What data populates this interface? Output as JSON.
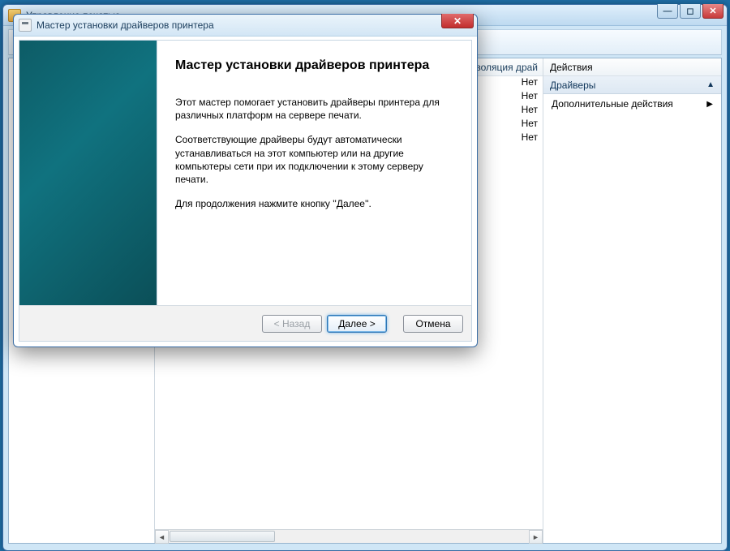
{
  "parent_window": {
    "title": "Управление печатью",
    "win_controls": {
      "min": "—",
      "max": "◻",
      "close": "✕"
    }
  },
  "mid_pane": {
    "column_header": "Изоляция драй",
    "rows": [
      "Нет",
      "Нет",
      "Нет",
      "Нет",
      "Нет"
    ]
  },
  "actions_pane": {
    "title": "Действия",
    "group": "Драйверы",
    "item": "Дополнительные действия"
  },
  "wizard": {
    "title": "Мастер установки драйверов принтера",
    "heading": "Мастер установки драйверов принтера",
    "para1": "Этот мастер помогает установить драйверы принтера для различных платформ на сервере печати.",
    "para2": "Соответствующие драйверы будут автоматически устанавливаться на этот компьютер или на другие компьютеры сети при их подключении к этому серверу печати.",
    "para3": "Для продолжения нажмите кнопку ''Далее''.",
    "buttons": {
      "back": "< Назад",
      "next": "Далее >",
      "cancel": "Отмена"
    },
    "close_glyph": "✕"
  }
}
